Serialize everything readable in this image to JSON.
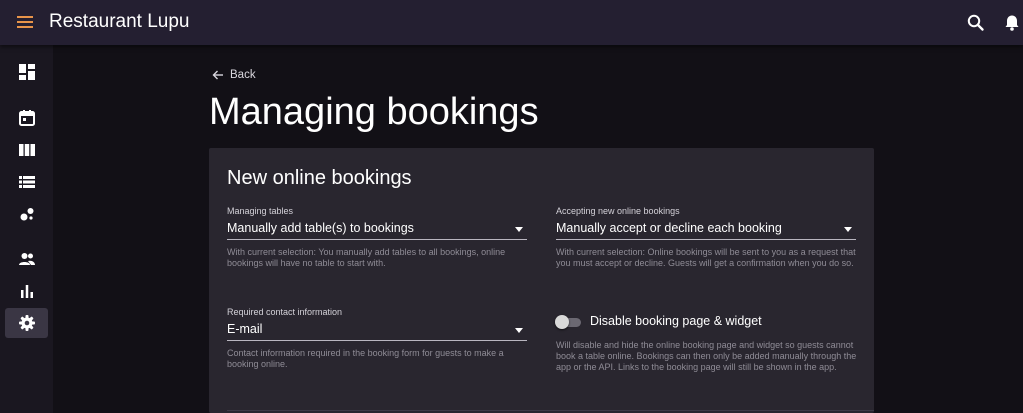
{
  "appbar": {
    "title": "Restaurant Lupu",
    "menu_icon": "menu-icon",
    "search_icon": "search-icon",
    "notifications_icon": "bell-icon",
    "accent_color": "#e8944a"
  },
  "rail": {
    "items": [
      {
        "icon": "dashboard-icon",
        "active": false
      },
      {
        "icon": "calendar-icon",
        "active": false
      },
      {
        "icon": "columns-icon",
        "active": false
      },
      {
        "icon": "list-icon",
        "active": false
      },
      {
        "icon": "bubbles-icon",
        "active": false
      },
      {
        "icon": "people-icon",
        "active": false
      },
      {
        "icon": "bar-chart-icon",
        "active": false
      },
      {
        "icon": "settings-icon",
        "active": true
      }
    ]
  },
  "main": {
    "back_label": "Back",
    "page_title": "Managing bookings",
    "card": {
      "title": "New online bookings",
      "managing_tables": {
        "label": "Managing tables",
        "value": "Manually add table(s) to bookings",
        "help": "With current selection: You manually add tables to all bookings, online bookings will have no table to start with."
      },
      "accepting": {
        "label": "Accepting new online bookings",
        "value": "Manually accept or decline each booking",
        "help": "With current selection: Online bookings will be sent to you as a request that you must accept or decline. Guests will get a confirmation when you do so."
      },
      "contact": {
        "label": "Required contact information",
        "value": "E-mail",
        "help": "Contact information required in the booking form for guests to make a booking online."
      },
      "disable": {
        "label": "Disable booking page & widget",
        "checked": false,
        "help": "Will disable and hide the online booking page and widget so guests cannot book a table online. Bookings can then only be added manually through the app or the API. Links to the booking page will still be shown in the app."
      }
    }
  }
}
